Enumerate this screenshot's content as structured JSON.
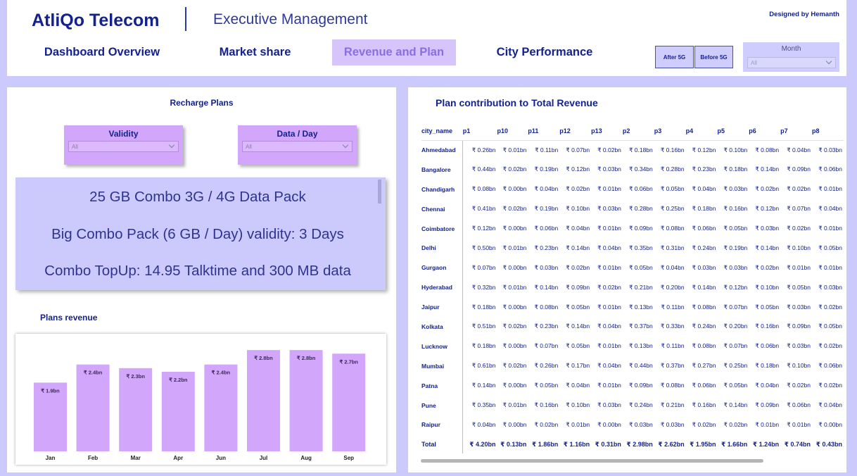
{
  "header": {
    "brand": "AtliQo Telecom",
    "subtitle": "Executive Management",
    "designed_by": "Designed by Hemanth",
    "nav": [
      "Dashboard Overview",
      "Market share",
      "Revenue and Plan",
      "City Performance"
    ],
    "active_nav": "Revenue and Plan",
    "filter_buttons": [
      "After 5G",
      "Before 5G"
    ],
    "month_label": "Month",
    "month_value": "All"
  },
  "left": {
    "recharge_title": "Recharge Plans",
    "validity_label": "Validity",
    "validity_value": "All",
    "data_label": "Data / Day",
    "data_value": "All",
    "plans": [
      "25 GB Combo 3G / 4G Data Pack",
      "Big Combo Pack (6 GB / Day) validity: 3 Days",
      "Combo TopUp: 14.95 Talktime and 300 MB data"
    ],
    "plans_revenue_title": "Plans revenue"
  },
  "chart_data": {
    "type": "bar",
    "title": "Plans revenue",
    "categories": [
      "Jan",
      "Feb",
      "Mar",
      "Apr",
      "Jun",
      "Jul",
      "Aug",
      "Sep"
    ],
    "values": [
      1.9,
      2.4,
      2.3,
      2.2,
      2.4,
      2.8,
      2.8,
      2.7
    ],
    "labels": [
      "₹ 1.9bn",
      "₹ 2.4bn",
      "₹ 2.3bn",
      "₹ 2.2bn",
      "₹ 2.4bn",
      "₹ 2.8bn",
      "₹ 2.8bn",
      "₹ 2.7bn"
    ],
    "bar_color": "#d2a6fb",
    "ylim": [
      0,
      2.9
    ]
  },
  "right": {
    "title": "Plan contribution to Total Revenue",
    "columns": [
      "city_name",
      "p1",
      "p10",
      "p11",
      "p12",
      "p13",
      "p2",
      "p3",
      "p4",
      "p5",
      "p6",
      "p7",
      "p8"
    ],
    "rows": [
      [
        "Ahmedabad",
        "₹ 0.26bn",
        "₹ 0.01bn",
        "₹ 0.11bn",
        "₹ 0.07bn",
        "₹ 0.02bn",
        "₹ 0.18bn",
        "₹ 0.16bn",
        "₹ 0.12bn",
        "₹ 0.10bn",
        "₹ 0.08bn",
        "₹ 0.04bn",
        "₹ 0.03bn"
      ],
      [
        "Bangalore",
        "₹ 0.44bn",
        "₹ 0.02bn",
        "₹ 0.19bn",
        "₹ 0.12bn",
        "₹ 0.03bn",
        "₹ 0.34bn",
        "₹ 0.28bn",
        "₹ 0.23bn",
        "₹ 0.18bn",
        "₹ 0.14bn",
        "₹ 0.09bn",
        "₹ 0.06bn"
      ],
      [
        "Chandigarh",
        "₹ 0.08bn",
        "₹ 0.00bn",
        "₹ 0.04bn",
        "₹ 0.02bn",
        "₹ 0.01bn",
        "₹ 0.06bn",
        "₹ 0.05bn",
        "₹ 0.04bn",
        "₹ 0.03bn",
        "₹ 0.02bn",
        "₹ 0.02bn",
        "₹ 0.01bn"
      ],
      [
        "Chennai",
        "₹ 0.41bn",
        "₹ 0.02bn",
        "₹ 0.19bn",
        "₹ 0.10bn",
        "₹ 0.03bn",
        "₹ 0.28bn",
        "₹ 0.25bn",
        "₹ 0.18bn",
        "₹ 0.16bn",
        "₹ 0.12bn",
        "₹ 0.07bn",
        "₹ 0.04bn"
      ],
      [
        "Coimbatore",
        "₹ 0.12bn",
        "₹ 0.00bn",
        "₹ 0.06bn",
        "₹ 0.04bn",
        "₹ 0.01bn",
        "₹ 0.09bn",
        "₹ 0.08bn",
        "₹ 0.06bn",
        "₹ 0.05bn",
        "₹ 0.03bn",
        "₹ 0.02bn",
        "₹ 0.01bn"
      ],
      [
        "Delhi",
        "₹ 0.50bn",
        "₹ 0.01bn",
        "₹ 0.23bn",
        "₹ 0.14bn",
        "₹ 0.04bn",
        "₹ 0.35bn",
        "₹ 0.31bn",
        "₹ 0.24bn",
        "₹ 0.19bn",
        "₹ 0.14bn",
        "₹ 0.10bn",
        "₹ 0.05bn"
      ],
      [
        "Gurgaon",
        "₹ 0.07bn",
        "₹ 0.00bn",
        "₹ 0.03bn",
        "₹ 0.02bn",
        "₹ 0.01bn",
        "₹ 0.05bn",
        "₹ 0.04bn",
        "₹ 0.03bn",
        "₹ 0.03bn",
        "₹ 0.02bn",
        "₹ 0.01bn",
        "₹ 0.01bn"
      ],
      [
        "Hyderabad",
        "₹ 0.32bn",
        "₹ 0.01bn",
        "₹ 0.14bn",
        "₹ 0.09bn",
        "₹ 0.02bn",
        "₹ 0.21bn",
        "₹ 0.20bn",
        "₹ 0.14bn",
        "₹ 0.12bn",
        "₹ 0.10bn",
        "₹ 0.05bn",
        "₹ 0.03bn"
      ],
      [
        "Jaipur",
        "₹ 0.18bn",
        "₹ 0.00bn",
        "₹ 0.08bn",
        "₹ 0.05bn",
        "₹ 0.01bn",
        "₹ 0.13bn",
        "₹ 0.11bn",
        "₹ 0.08bn",
        "₹ 0.07bn",
        "₹ 0.05bn",
        "₹ 0.03bn",
        "₹ 0.02bn"
      ],
      [
        "Kolkata",
        "₹ 0.51bn",
        "₹ 0.02bn",
        "₹ 0.23bn",
        "₹ 0.14bn",
        "₹ 0.04bn",
        "₹ 0.37bn",
        "₹ 0.33bn",
        "₹ 0.24bn",
        "₹ 0.20bn",
        "₹ 0.16bn",
        "₹ 0.09bn",
        "₹ 0.05bn"
      ],
      [
        "Lucknow",
        "₹ 0.18bn",
        "₹ 0.00bn",
        "₹ 0.07bn",
        "₹ 0.05bn",
        "₹ 0.01bn",
        "₹ 0.13bn",
        "₹ 0.11bn",
        "₹ 0.08bn",
        "₹ 0.07bn",
        "₹ 0.06bn",
        "₹ 0.03bn",
        "₹ 0.02bn"
      ],
      [
        "Mumbai",
        "₹ 0.61bn",
        "₹ 0.02bn",
        "₹ 0.26bn",
        "₹ 0.17bn",
        "₹ 0.04bn",
        "₹ 0.44bn",
        "₹ 0.37bn",
        "₹ 0.27bn",
        "₹ 0.25bn",
        "₹ 0.18bn",
        "₹ 0.10bn",
        "₹ 0.06bn"
      ],
      [
        "Patna",
        "₹ 0.14bn",
        "₹ 0.00bn",
        "₹ 0.05bn",
        "₹ 0.04bn",
        "₹ 0.01bn",
        "₹ 0.09bn",
        "₹ 0.08bn",
        "₹ 0.06bn",
        "₹ 0.05bn",
        "₹ 0.04bn",
        "₹ 0.02bn",
        "₹ 0.02bn"
      ],
      [
        "Pune",
        "₹ 0.35bn",
        "₹ 0.01bn",
        "₹ 0.16bn",
        "₹ 0.10bn",
        "₹ 0.03bn",
        "₹ 0.24bn",
        "₹ 0.21bn",
        "₹ 0.16bn",
        "₹ 0.14bn",
        "₹ 0.09bn",
        "₹ 0.06bn",
        "₹ 0.04bn"
      ],
      [
        "Raipur",
        "₹ 0.04bn",
        "₹ 0.00bn",
        "₹ 0.02bn",
        "₹ 0.01bn",
        "₹ 0.00bn",
        "₹ 0.03bn",
        "₹ 0.03bn",
        "₹ 0.02bn",
        "₹ 0.02bn",
        "₹ 0.01bn",
        "₹ 0.01bn",
        "₹ 0.00bn"
      ]
    ],
    "total": [
      "Total",
      "₹ 4.20bn",
      "₹ 0.13bn",
      "₹ 1.86bn",
      "₹ 1.16bn",
      "₹ 0.31bn",
      "₹ 2.98bn",
      "₹ 2.62bn",
      "₹ 1.95bn",
      "₹ 1.66bn",
      "₹ 1.24bn",
      "₹ 0.74bn",
      "₹ 0.43bn"
    ]
  }
}
